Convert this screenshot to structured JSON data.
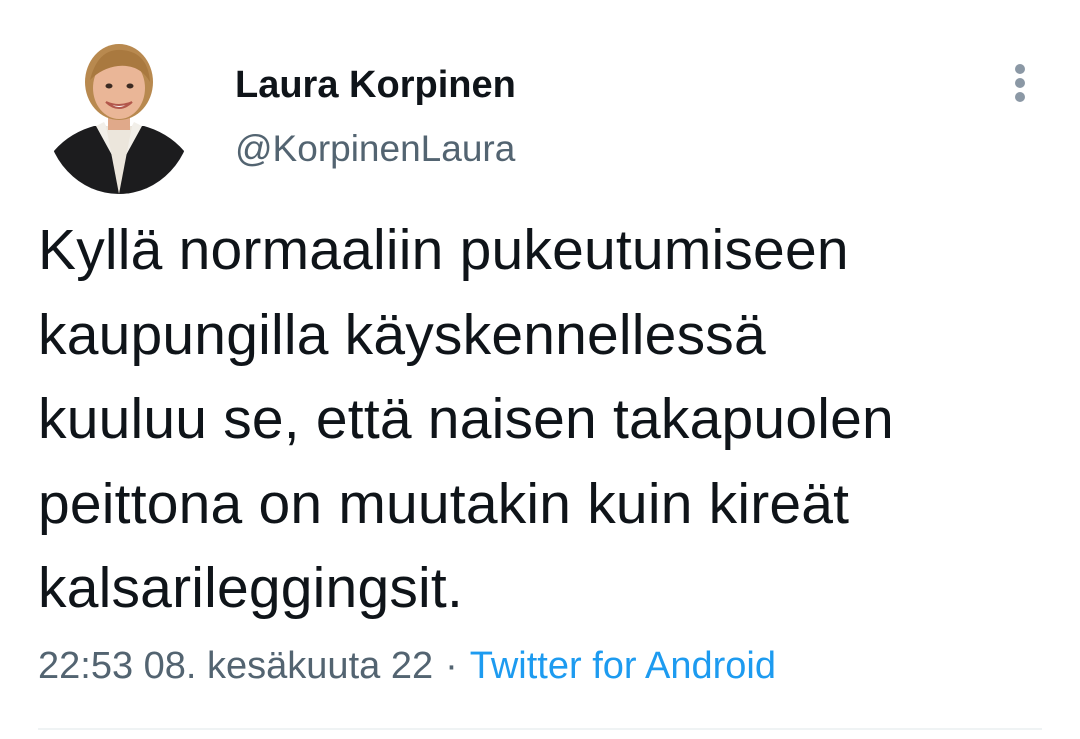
{
  "author": {
    "display_name": "Laura Korpinen",
    "handle": "@KorpinenLaura"
  },
  "tweet": {
    "text_lines": [
      "Kyllä normaaliin pukeutumiseen",
      "kaupungilla käyskennellessä",
      "kuuluu se, että naisen takapuolen",
      "peittona on muutakin kuin kireät",
      "kalsarileggingsit."
    ],
    "time": "22:53 08. kesäkuuta 22",
    "separator": "·",
    "source": "Twitter for Android"
  },
  "icons": {
    "more": "more-vertical-icon",
    "avatar": "profile-photo"
  },
  "colors": {
    "text_primary": "#0f1419",
    "text_secondary": "#536471",
    "link": "#1d9bf0",
    "icon_gray": "#8b98a5",
    "divider": "#eff3f4"
  }
}
